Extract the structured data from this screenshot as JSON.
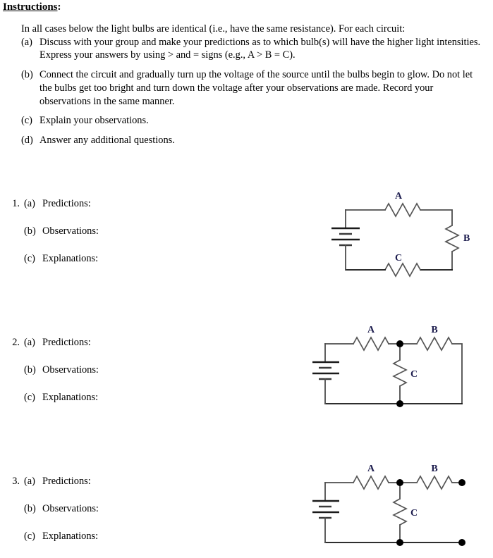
{
  "document": {
    "heading": "Instructions",
    "heading_colon": ":",
    "intro": "In all cases below the light bulbs are identical (i.e., have the same resistance). For each circuit:",
    "instruction_items": [
      {
        "marker": "(a)",
        "text": "Discuss with your group and make your predictions as to which bulb(s) will have the higher light intensities. Express your answers by using > and = signs (e.g., A > B = C)."
      },
      {
        "marker": "(b)",
        "text": "Connect the circuit and gradually turn up the voltage of the source until the bulbs begin to glow. Do not let the bulbs get too bright and turn down the voltage after your observations are made. Record your observations in the same manner."
      },
      {
        "marker": "(c)",
        "text": "Explain your observations."
      },
      {
        "marker": "(d)",
        "text": "Answer any additional questions."
      }
    ]
  },
  "exercises": [
    {
      "number": "1.",
      "rows": [
        {
          "marker": "(a)",
          "label": "Predictions:"
        },
        {
          "marker": "(b)",
          "label": "Observations:"
        },
        {
          "marker": "(c)",
          "label": "Explanations:"
        }
      ],
      "circuit": {
        "name": "series-circuit",
        "description": "Single series loop: battery, bulb A on top, bulb B on right side, bulb C on bottom",
        "labels": {
          "a": "A",
          "b": "B",
          "c": "C"
        }
      }
    },
    {
      "number": "2.",
      "rows": [
        {
          "marker": "(a)",
          "label": "Predictions:"
        },
        {
          "marker": "(b)",
          "label": "Observations:"
        },
        {
          "marker": "(c)",
          "label": "Explanations:"
        }
      ],
      "circuit": {
        "name": "parallel-branch-closed-circuit",
        "description": "Battery with bulb A in series, junction node feeding bulb C in a parallel vertical branch and bulb B continuing to the closed right side",
        "labels": {
          "a": "A",
          "b": "B",
          "c": "C"
        }
      }
    },
    {
      "number": "3.",
      "rows": [
        {
          "marker": "(a)",
          "label": "Predictions:"
        },
        {
          "marker": "(b)",
          "label": "Observations:"
        },
        {
          "marker": "(c)",
          "label": "Explanations:"
        }
      ],
      "circuit": {
        "name": "parallel-branch-open-terminals-circuit",
        "description": "Same as circuit 2 but the right hand side is open: bulb B ends at an open terminal dot and the bottom wire ends at a second open terminal dot",
        "labels": {
          "a": "A",
          "b": "B",
          "c": "C"
        }
      }
    }
  ],
  "colors": {
    "page_background": "#ffffff",
    "text": "#000000",
    "wire": "#4d4d4d",
    "wire_dark": "#111111",
    "resistor": "#555555",
    "bulb_label": "#1b1b4d",
    "node_dot": "#000000"
  }
}
